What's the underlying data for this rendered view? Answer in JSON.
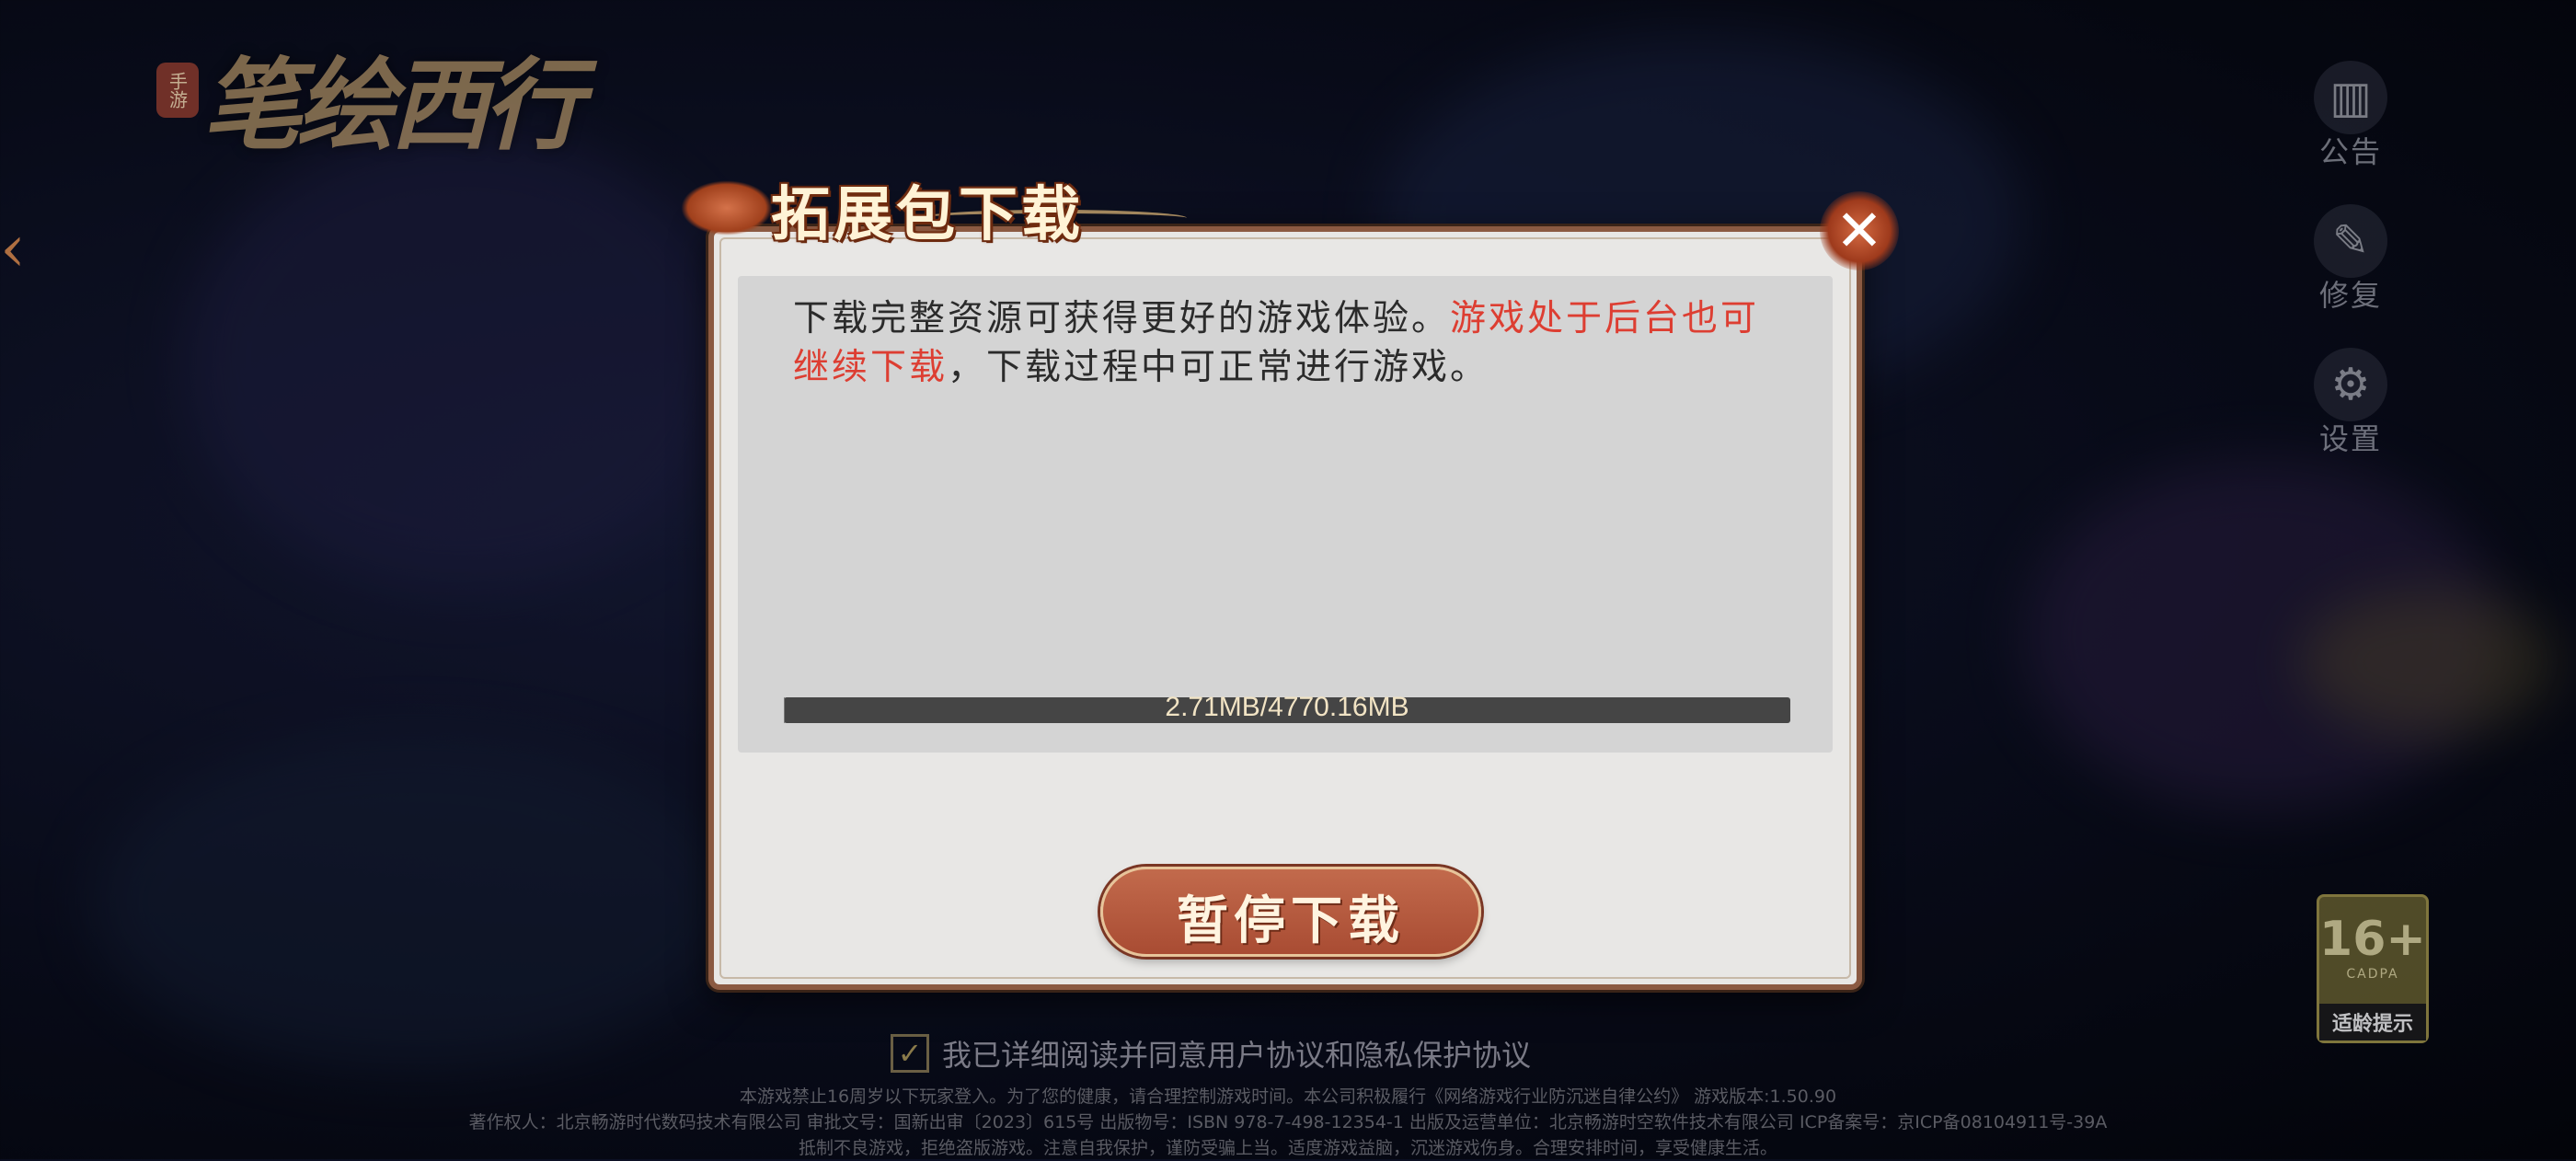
{
  "game": {
    "logo_text": "笔绘西行",
    "logo_seal": "手游"
  },
  "side_menu": [
    {
      "label": "公告",
      "icon": "notice-icon"
    },
    {
      "label": "修复",
      "icon": "repair-icon"
    },
    {
      "label": "设置",
      "icon": "gear-icon"
    }
  ],
  "age_badge": {
    "rating": "16+",
    "code": "CADPA",
    "tip": "适龄提示"
  },
  "agreement": {
    "text": "我已详细阅读并同意用户协议和隐私保护协议",
    "checked": true
  },
  "footer": {
    "line1": "本游戏禁止16周岁以下玩家登入。为了您的健康，请合理控制游戏时间。本公司积极履行《网络游戏行业防沉迷自律公约》 游戏版本:1.50.90",
    "line2": "著作权人：北京畅游时代数码技术有限公司 审批文号：国新出审〔2023〕615号 出版物号：ISBN 978-7-498-12354-1 出版及运营单位：北京畅游时空软件技术有限公司 ICP备案号：京ICP备08104911号-39A",
    "line3": "抵制不良游戏，拒绝盗版游戏。注意自我保护，谨防受骗上当。适度游戏益脑，沉迷游戏伤身。合理安排时间，享受健康生活。"
  },
  "dialog": {
    "title": "拓展包下载",
    "desc_normal_1": "下载完整资源可获得更好的游戏体验。",
    "desc_red": "游戏处于后台也可继续下载",
    "desc_normal_2": "，下载过程中可正常进行游戏。",
    "progress": {
      "downloaded": "2.71MB",
      "total": "4770.16MB",
      "label": "2.71MB/4770.16MB",
      "fraction": 0.00057
    },
    "pause_button": "暂停下载",
    "close_icon": "close-icon"
  },
  "colors": {
    "accent_red": "#dd3e32",
    "button_fill": "#b0553a",
    "dialog_bg": "#e8e7e5"
  }
}
